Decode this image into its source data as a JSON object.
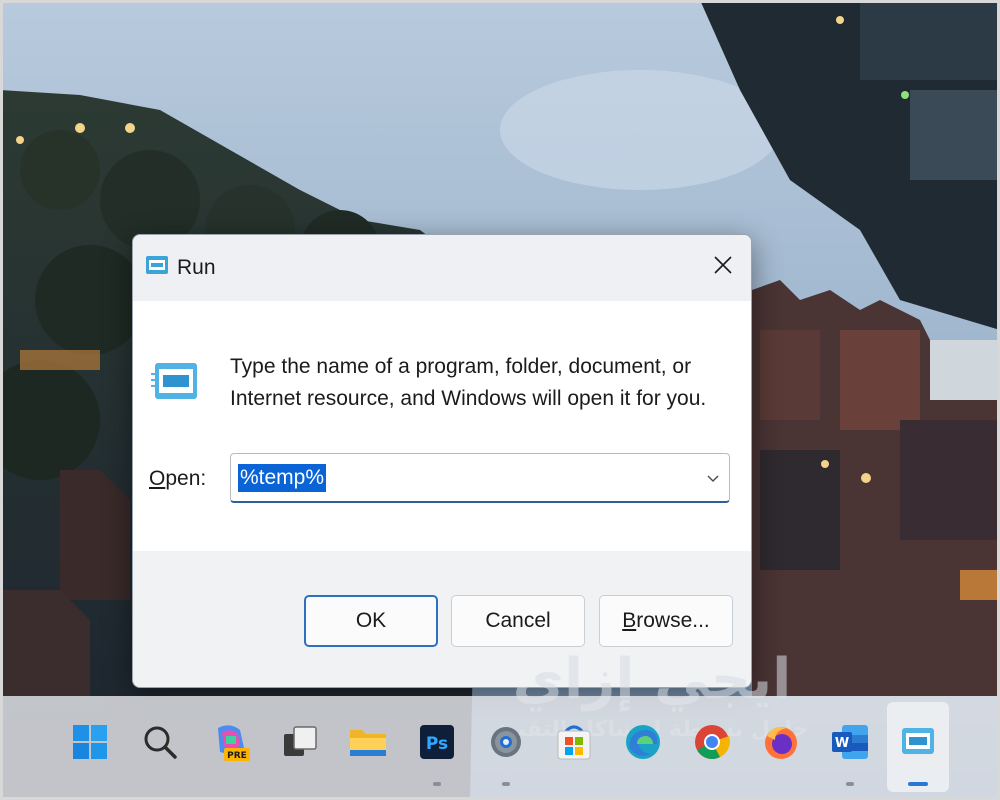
{
  "dialog": {
    "title": "Run",
    "description": "Type the name of a program, folder, document, or Internet resource, and Windows will open it for you.",
    "open_label_mnemonic": "O",
    "open_label_rest": "pen:",
    "open_value": "%temp%",
    "ok_label": "OK",
    "cancel_label": "Cancel",
    "browse_label_mnemonic": "B",
    "browse_label_rest": "rowse..."
  },
  "watermark": {
    "main": "ايجي إزاي",
    "sub": "حلول بسيطة لمشاكل التقنية"
  },
  "taskbar": {
    "items": [
      {
        "icon": "windows-start-icon",
        "running": false
      },
      {
        "icon": "search-icon",
        "running": false
      },
      {
        "icon": "copilot-icon",
        "badge": "PRE",
        "running": false
      },
      {
        "icon": "task-view-icon",
        "running": false
      },
      {
        "icon": "file-explorer-icon",
        "running": false
      },
      {
        "icon": "photoshop-icon",
        "label": "Ps",
        "running": true
      },
      {
        "icon": "settings-gear-icon",
        "running": true
      },
      {
        "icon": "microsoft-store-icon",
        "running": false
      },
      {
        "icon": "edge-icon",
        "running": false
      },
      {
        "icon": "chrome-icon",
        "running": false
      },
      {
        "icon": "firefox-icon",
        "running": false
      },
      {
        "icon": "word-icon",
        "label": "W",
        "running": true
      },
      {
        "icon": "run-icon",
        "running": true,
        "active": true
      }
    ]
  },
  "colors": {
    "accent": "#0a64d6",
    "focus_border": "#2f6fbf"
  }
}
